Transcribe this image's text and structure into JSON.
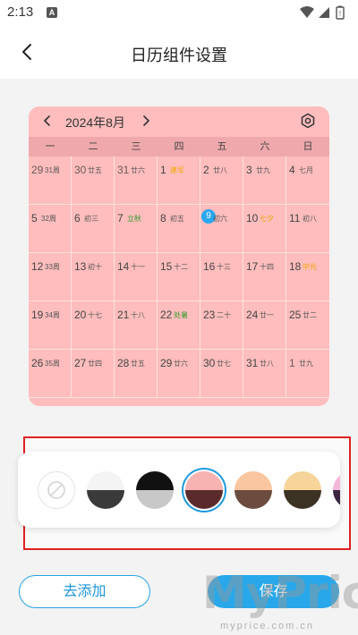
{
  "status_bar": {
    "time": "2:13",
    "notification_icon": "A",
    "icons": [
      "wifi-icon",
      "signal-icon",
      "battery-icon"
    ]
  },
  "header": {
    "title": "日历组件设置",
    "back_icon": "chevron-left-icon"
  },
  "calendar": {
    "month_label": "2024年8月",
    "weekdays": [
      "一",
      "二",
      "三",
      "四",
      "五",
      "六",
      "日"
    ],
    "today": "9",
    "weeks": [
      [
        {
          "day": "29",
          "sub": "31周",
          "muted": true
        },
        {
          "day": "30",
          "sub": "廿五",
          "muted": true
        },
        {
          "day": "31",
          "sub": "廿六",
          "muted": true
        },
        {
          "day": "1",
          "sub": "建军",
          "style": "holiday"
        },
        {
          "day": "2",
          "sub": "廿八"
        },
        {
          "day": "3",
          "sub": "廿九"
        },
        {
          "day": "4",
          "sub": "七月"
        }
      ],
      [
        {
          "day": "5",
          "sub": "32周"
        },
        {
          "day": "6",
          "sub": "初三"
        },
        {
          "day": "7",
          "sub": "立秋",
          "style": "term"
        },
        {
          "day": "8",
          "sub": "初五"
        },
        {
          "day": "9",
          "sub": "初六",
          "today": true
        },
        {
          "day": "10",
          "sub": "七夕",
          "style": "holiday"
        },
        {
          "day": "11",
          "sub": "初八"
        }
      ],
      [
        {
          "day": "12",
          "sub": "33周"
        },
        {
          "day": "13",
          "sub": "初十"
        },
        {
          "day": "14",
          "sub": "十一"
        },
        {
          "day": "15",
          "sub": "十二"
        },
        {
          "day": "16",
          "sub": "十三"
        },
        {
          "day": "17",
          "sub": "十四"
        },
        {
          "day": "18",
          "sub": "中元",
          "style": "holiday"
        }
      ],
      [
        {
          "day": "19",
          "sub": "34周"
        },
        {
          "day": "20",
          "sub": "十七"
        },
        {
          "day": "21",
          "sub": "十八"
        },
        {
          "day": "22",
          "sub": "处暑",
          "style": "term"
        },
        {
          "day": "23",
          "sub": "二十"
        },
        {
          "day": "24",
          "sub": "廿一"
        },
        {
          "day": "25",
          "sub": "廿二"
        }
      ],
      [
        {
          "day": "26",
          "sub": "35周"
        },
        {
          "day": "27",
          "sub": "廿四"
        },
        {
          "day": "28",
          "sub": "廿五"
        },
        {
          "day": "29",
          "sub": "廿六"
        },
        {
          "day": "30",
          "sub": "廿七"
        },
        {
          "day": "31",
          "sub": "廿八"
        },
        {
          "day": "1",
          "sub": "廿九",
          "muted": true
        }
      ]
    ]
  },
  "theme_swatches": [
    {
      "name": "none",
      "top": "#ffffff",
      "bottom": "#ffffff"
    },
    {
      "name": "white-dark",
      "top": "#f4f4f4",
      "bottom": "#3a3a3a"
    },
    {
      "name": "black-gray",
      "top": "#111111",
      "bottom": "#c8c8c8"
    },
    {
      "name": "pink-maroon",
      "top": "#f7b2b2",
      "bottom": "#5b2b2b",
      "selected": true
    },
    {
      "name": "peach-brown",
      "top": "#f9c6a0",
      "bottom": "#6b4c3f"
    },
    {
      "name": "sand-dark",
      "top": "#f6d49a",
      "bottom": "#3b3224"
    },
    {
      "name": "pink-purple",
      "top": "#f4b6d9",
      "bottom": "#3a2440"
    }
  ],
  "colors": {
    "accent": "#28a8ea",
    "calendar_bg": "#ffbdbd",
    "selection_border": "#e02020"
  },
  "actions": {
    "add_label": "去添加",
    "save_label": "保存"
  },
  "watermark": {
    "brand": "MyPrice",
    "url": "myprice.com.cn"
  }
}
